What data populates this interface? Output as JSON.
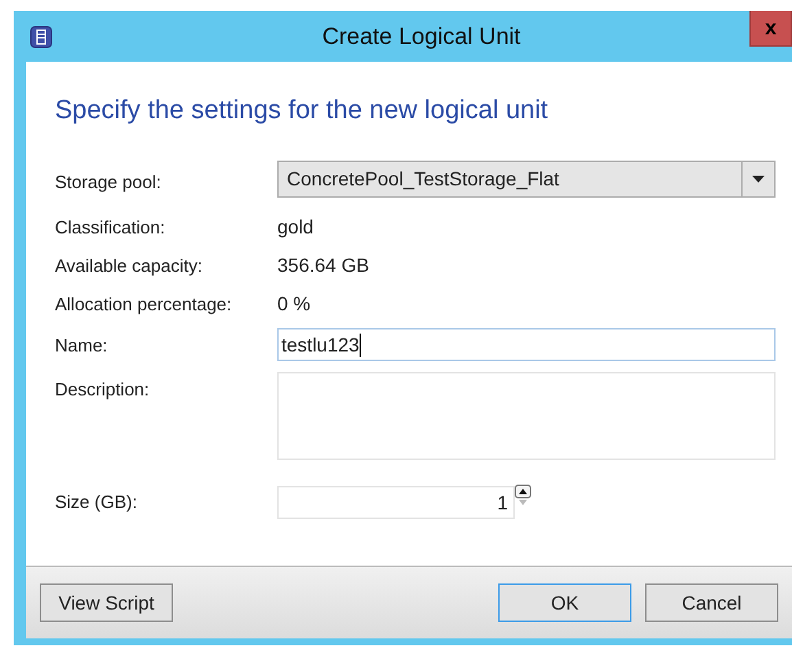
{
  "window": {
    "title": "Create Logical Unit"
  },
  "heading": "Specify the settings for the new logical unit",
  "fields": [
    {
      "kind": "dropdown",
      "label": "Storage pool:",
      "value": "ConcretePool_TestStorage_Flat"
    },
    {
      "kind": "text",
      "label": "Classification:",
      "value": "gold"
    },
    {
      "kind": "text",
      "label": "Available capacity:",
      "value": "356.64 GB"
    },
    {
      "kind": "text",
      "label": "Allocation percentage:",
      "value": "0 %"
    },
    {
      "kind": "input",
      "label": "Name:",
      "value": "testlu123",
      "focused": true
    },
    {
      "kind": "textarea",
      "label": "Description:"
    },
    {
      "kind": "spinner",
      "label": "Size (GB):",
      "value": "1"
    }
  ],
  "buttons": [
    {
      "label": "View Script",
      "default": false
    },
    {
      "label": "OK",
      "default": true
    },
    {
      "label": "Cancel",
      "default": false
    }
  ],
  "close_button": "x"
}
